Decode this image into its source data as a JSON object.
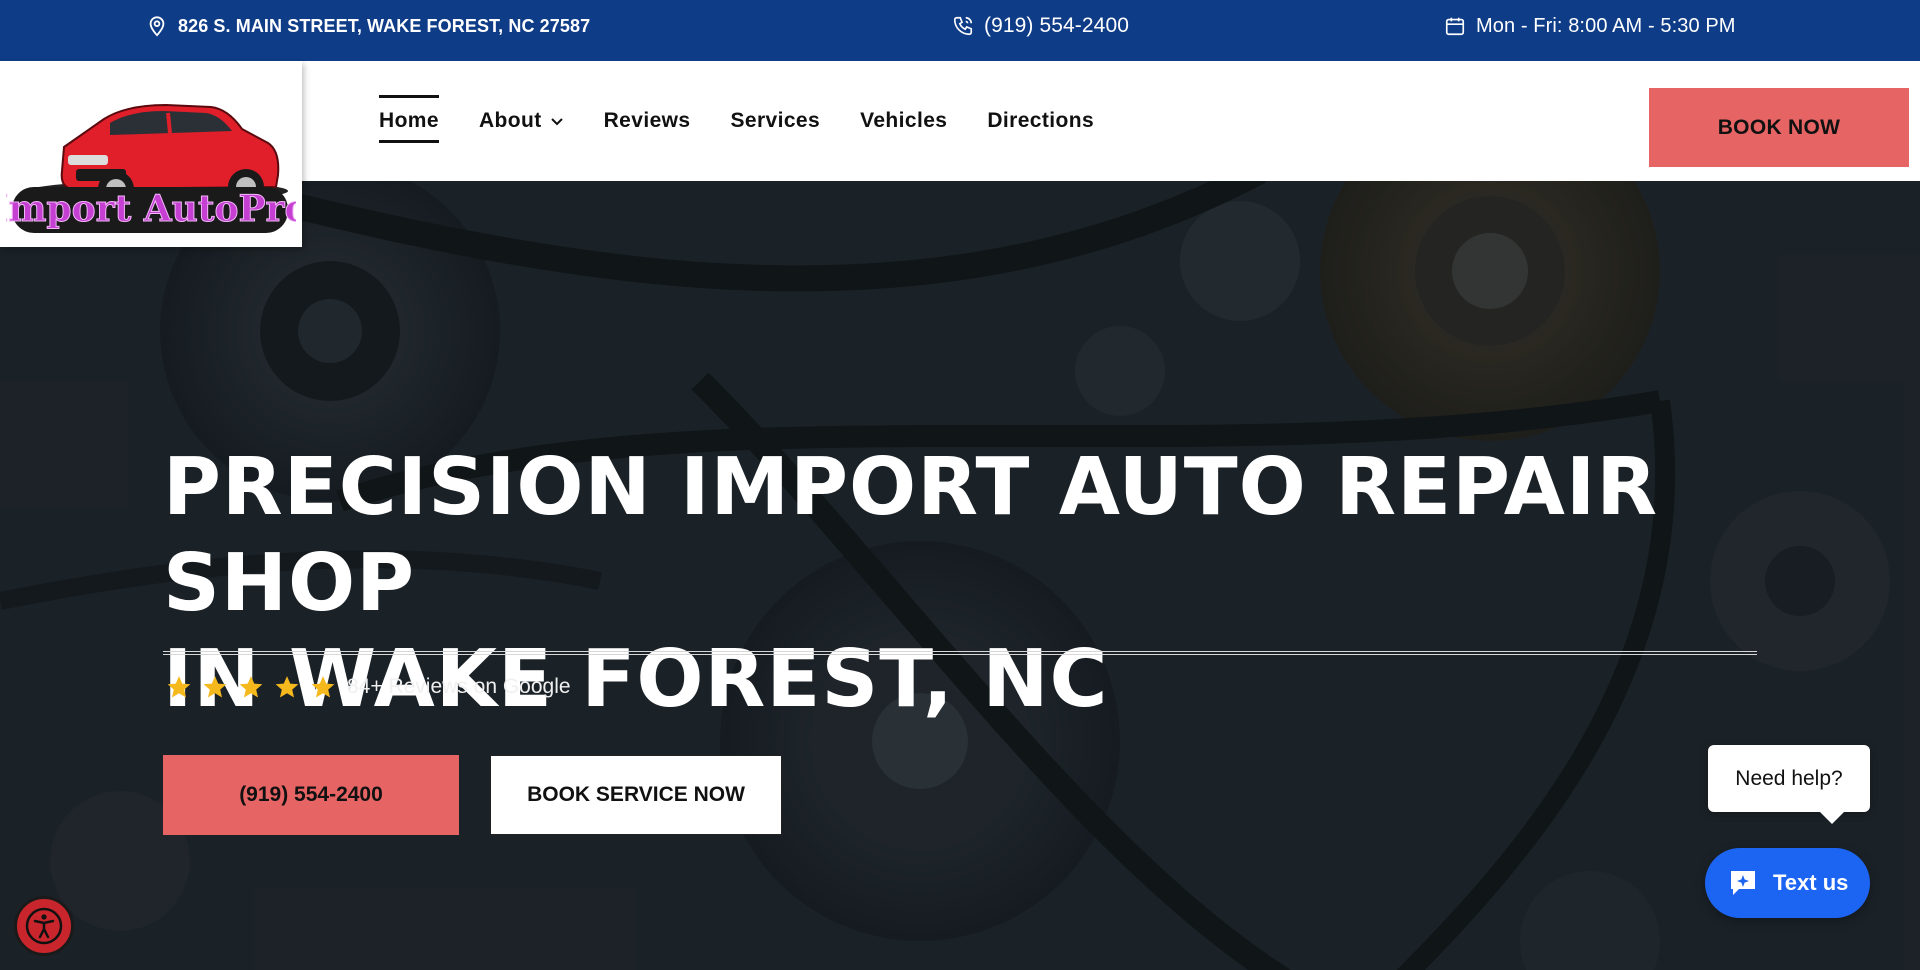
{
  "topbar": {
    "address": "826 S. MAIN STREET, WAKE FOREST, NC 27587",
    "phone": "(919) 554-2400",
    "hours": "Mon - Fri: 8:00 AM - 5:30 PM"
  },
  "logo": {
    "text": "Import AutoPro"
  },
  "nav": {
    "items": [
      {
        "label": "Home",
        "active": true
      },
      {
        "label": "About",
        "has_dropdown": true
      },
      {
        "label": "Reviews"
      },
      {
        "label": "Services"
      },
      {
        "label": "Vehicles"
      },
      {
        "label": "Directions"
      }
    ],
    "book_now": "BOOK NOW"
  },
  "hero": {
    "title_line1": "PRECISION IMPORT AUTO REPAIR SHOP",
    "title_line2": "IN WAKE FOREST, NC",
    "rating_stars": 5,
    "rating_text": "84+ Reviews on Google",
    "call_button": "(919) 554-2400",
    "book_service_button": "BOOK SERVICE NOW"
  },
  "chat": {
    "prompt": "Need help?",
    "button": "Text us"
  },
  "colors": {
    "topbar": "#0f3c87",
    "accent": "#e66464",
    "chat": "#1c64f2",
    "star": "#f5b91d"
  },
  "icons": [
    "location-pin-icon",
    "phone-icon",
    "calendar-icon",
    "chevron-down-icon",
    "star-icon",
    "chat-sparkle-icon",
    "accessibility-icon"
  ]
}
